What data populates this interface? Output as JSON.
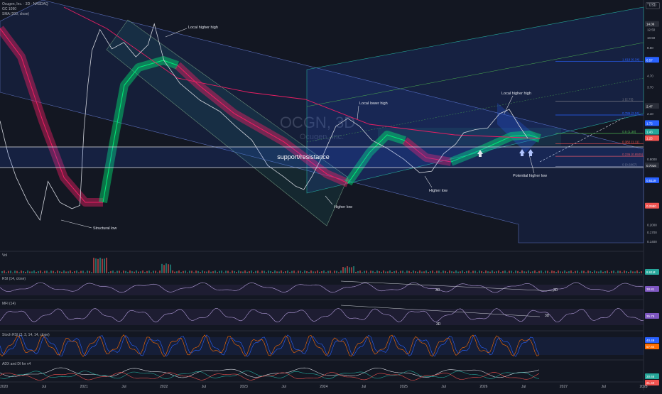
{
  "header": {
    "symbol_line": "Ocugen, Inc. · 3D · NASDAQ",
    "indicator1": "GC 1090",
    "indicator2": "SMA (200, close)",
    "currency": "USD"
  },
  "watermark": {
    "ticker": "OCGN, 3D",
    "company": "Ocugen, Inc."
  },
  "annotations": {
    "structural_low": "Structural low",
    "local_higher_high_1": "Local higher high",
    "local_lower_high": "Local lower high",
    "higher_low_1": "Higher low",
    "higher_low_2": "Higher low",
    "local_higher_high_2": "Local higher high",
    "potential_higher_low": "Potential higher low",
    "support_resistance": "support/resistance"
  },
  "fib_levels": [
    {
      "label": "1.618 (6.34)",
      "price": 6.34
    },
    {
      "label": "1 (2.73)",
      "price": 2.73
    },
    {
      "label": "0.786 (2.04)",
      "price": 2.04
    },
    {
      "label": "0.5 (1.38)",
      "price": 1.38
    },
    {
      "label": "0.382 (1.11)",
      "price": 1.11
    },
    {
      "label": "0.236 (0.8505)",
      "price": 0.8505
    },
    {
      "label": "0 (0.6867)",
      "price": 0.6867
    }
  ],
  "price_axis": {
    "ticks": [
      "22.00",
      "14.06",
      "12.50",
      "10.50",
      "8.50",
      "6.57",
      "4.70",
      "3.70",
      "2.47",
      "2.10",
      "1.72",
      "1.43",
      "1.25",
      "0.8000",
      "0.7016",
      "0.5119",
      "0.3000",
      "0.2980",
      "0.2000",
      "0.1700",
      "0.1400"
    ],
    "scale": "log",
    "badges": [
      {
        "text": "14.06",
        "color": "#2a2e39",
        "price": 14.06
      },
      {
        "text": "6.57",
        "color": "#2962ff",
        "price": 6.57
      },
      {
        "text": "2.47",
        "color": "#2a2e39",
        "price": 2.47
      },
      {
        "text": "1.72",
        "color": "#2962ff",
        "price": 1.72
      },
      {
        "text": "1.43",
        "color": "#26a69a",
        "price": 1.43
      },
      {
        "text": "1.25",
        "color": "#ef5350",
        "price": 1.25
      },
      {
        "text": "0.7016",
        "color": "#2a2e39",
        "price": 0.7016
      },
      {
        "text": "0.5119",
        "color": "#2962ff",
        "price": 0.5119
      },
      {
        "text": "0.2980",
        "color": "#ef5350",
        "price": 0.298
      }
    ]
  },
  "time_axis": [
    "2020",
    "Jul",
    "2021",
    "Jul",
    "2022",
    "Jul",
    "2023",
    "Jul",
    "2024",
    "Jul",
    "2025",
    "Jul",
    "2026",
    "Jul",
    "2027",
    "Jul",
    "2028"
  ],
  "panes": [
    {
      "label": "Vol",
      "badge": "8.61M",
      "badge_color": "#26a69a"
    },
    {
      "label": "RSI (14, close)",
      "badge": "38.81",
      "badge_color": "#7e57c2",
      "note": "3D"
    },
    {
      "label": "MFI (14)",
      "badge": "35.75",
      "badge_color": "#7e57c2",
      "note": "3D"
    },
    {
      "label": "Stoch RSI (3, 3, 14, 14, close)",
      "badge": "40.49",
      "badge_color": "#2962ff",
      "badge2": "57.84",
      "badge2_color": "#ff6d00"
    },
    {
      "label": "ADX and DI for v4",
      "badge": "30.66",
      "badge_color": "#26a69a",
      "badge2": "21.40",
      "badge2_color": "#ef5350"
    }
  ],
  "rsi_notes": [
    "3D",
    "3D"
  ],
  "mfi_notes": [
    "3D",
    "3D"
  ],
  "chart_data": {
    "type": "line",
    "title": "",
    "x": [
      "2020",
      "Jul",
      "2021",
      "Jul",
      "2022",
      "Jul",
      "2023",
      "Jul",
      "2024",
      "Jul",
      "2025",
      "Jul",
      "2026",
      "Jul",
      "2027",
      "Jul",
      "2028"
    ],
    "price_path": [
      {
        "t": 2019.95,
        "p": 1.8
      },
      {
        "t": 2020.05,
        "p": 0.9
      },
      {
        "t": 2020.15,
        "p": 0.55
      },
      {
        "t": 2020.3,
        "p": 0.32
      },
      {
        "t": 2020.45,
        "p": 0.22
      },
      {
        "t": 2020.55,
        "p": 0.5
      },
      {
        "t": 2020.7,
        "p": 0.32
      },
      {
        "t": 2020.85,
        "p": 0.28
      },
      {
        "t": 2020.95,
        "p": 0.3
      },
      {
        "t": 2021.0,
        "p": 1.5
      },
      {
        "t": 2021.05,
        "p": 3.9
      },
      {
        "t": 2021.1,
        "p": 8.0
      },
      {
        "t": 2021.2,
        "p": 12.5
      },
      {
        "t": 2021.35,
        "p": 8.3
      },
      {
        "t": 2021.5,
        "p": 9.5
      },
      {
        "t": 2021.65,
        "p": 7.0
      },
      {
        "t": 2021.8,
        "p": 9.0
      },
      {
        "t": 2021.88,
        "p": 14.06
      },
      {
        "t": 2022.0,
        "p": 6.5
      },
      {
        "t": 2022.2,
        "p": 4.0
      },
      {
        "t": 2022.45,
        "p": 2.8
      },
      {
        "t": 2022.7,
        "p": 2.2
      },
      {
        "t": 2022.9,
        "p": 1.6
      },
      {
        "t": 2023.1,
        "p": 1.2
      },
      {
        "t": 2023.3,
        "p": 0.7
      },
      {
        "t": 2023.5,
        "p": 0.55
      },
      {
        "t": 2023.65,
        "p": 0.45
      },
      {
        "t": 2023.75,
        "p": 0.42
      },
      {
        "t": 2023.85,
        "p": 0.55
      },
      {
        "t": 2024.0,
        "p": 0.9
      },
      {
        "t": 2024.15,
        "p": 1.6
      },
      {
        "t": 2024.3,
        "p": 1.9
      },
      {
        "t": 2024.45,
        "p": 1.6
      },
      {
        "t": 2024.6,
        "p": 1.2
      },
      {
        "t": 2024.8,
        "p": 1.0
      },
      {
        "t": 2025.0,
        "p": 0.8
      },
      {
        "t": 2025.2,
        "p": 0.6
      },
      {
        "t": 2025.35,
        "p": 0.62
      },
      {
        "t": 2025.5,
        "p": 0.9
      },
      {
        "t": 2025.65,
        "p": 1.1
      },
      {
        "t": 2025.75,
        "p": 1.4
      },
      {
        "t": 2025.9,
        "p": 1.5
      },
      {
        "t": 2026.05,
        "p": 1.55
      },
      {
        "t": 2026.2,
        "p": 2.1
      },
      {
        "t": 2026.32,
        "p": 2.3
      },
      {
        "t": 2026.45,
        "p": 1.6
      },
      {
        "t": 2026.55,
        "p": 1.25
      }
    ],
    "ylim": [
      0.14,
      22
    ],
    "xlim": [
      2019.95,
      2028.0
    ],
    "ylabel": "",
    "xlabel": "",
    "grid": true
  }
}
